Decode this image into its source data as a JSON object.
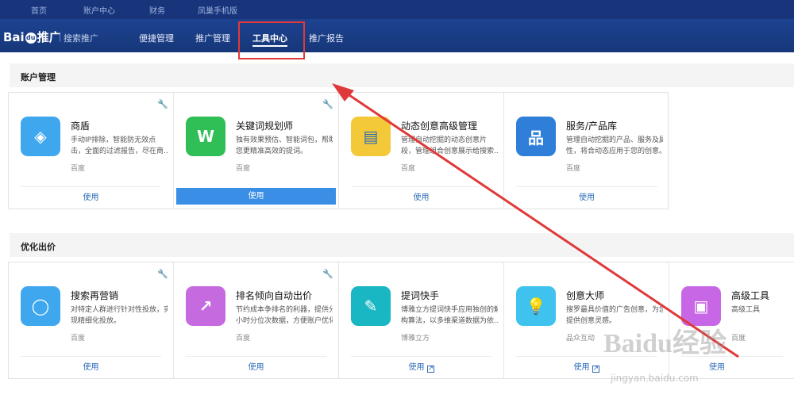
{
  "topbar": {
    "items": [
      "首页",
      "账户中心",
      "财务",
      "凤巢手机版"
    ]
  },
  "navbar": {
    "logo": "Bai",
    "logo_paw": "du",
    "logo_tail": "推广",
    "sub": "搜索推广",
    "items": [
      "便捷管理",
      "推广管理",
      "工具中心",
      "推广报告"
    ]
  },
  "sections": [
    {
      "title": "账户管理",
      "cards": [
        {
          "name": "商盾",
          "desc1": "手动IP排除，智能防无效点",
          "desc2": "击，全面的过滤报告，尽在商...",
          "source": "百度",
          "action": "使用"
        },
        {
          "name": "关键词规划师",
          "desc1": "独有效果预估、智能词包，帮助",
          "desc2": "您更精准高效的提词。",
          "source": "百度",
          "action": "使用"
        },
        {
          "name": "动态创意高级管理",
          "desc1": "管理自动挖掘的动态创意片",
          "desc2": "段，管理组合创意展示给搜索...",
          "source": "百度",
          "action": "使用"
        },
        {
          "name": "服务/产品库",
          "desc1": "管理自动挖掘的产品、服务及属",
          "desc2": "性，将合动态应用于您的创意。",
          "source": "百度",
          "action": "使用"
        }
      ]
    },
    {
      "title": "优化出价",
      "cards": [
        {
          "name": "搜索再营销",
          "desc1": "对特定人群进行针对性投放，实",
          "desc2": "现精细化投放。",
          "source": "百度",
          "action": "使用"
        },
        {
          "name": "排名倾向自动出价",
          "desc1": "节约成本争排名的利器，提供分",
          "desc2": "小时分位次数据，方便账户优化",
          "source": "百度",
          "action": "使用"
        },
        {
          "name": "提词快手",
          "desc1": "博雅立方提词快手应用独创的解",
          "desc2": "构算法，以多维渠道数据为依...",
          "source": "博雅立方",
          "action": "使用"
        },
        {
          "name": "创意大师",
          "desc1": "搜罗最具价值的广告创意，为您",
          "desc2": "提供创意灵感。",
          "source": "品众互动",
          "action": "使用"
        },
        {
          "name": "高级工具",
          "desc1": "高级工具",
          "desc2": "",
          "source": "百度",
          "action": "使用"
        }
      ]
    }
  ],
  "watermark": {
    "brand": "Baidu经验",
    "url": "jingyan.baidu.com"
  },
  "colors": {
    "nav_bg": "#1d4290",
    "accent": "#3a8ee6",
    "highlight_red": "#e0393a"
  }
}
